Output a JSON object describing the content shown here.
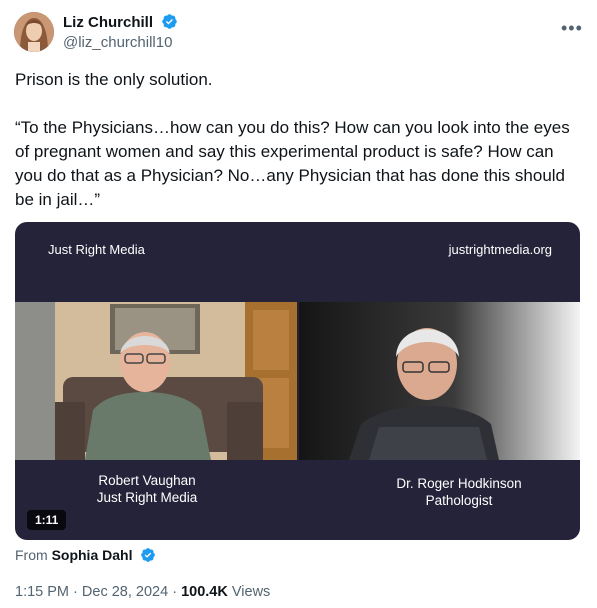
{
  "author": {
    "name": "Liz Churchill",
    "handle": "@liz_churchill10"
  },
  "tweet": {
    "text": "Prison is the only solution.\n\n“To the Physicians…how can you do this? How can you look into the eyes of pregnant women and say this experimental product is safe? How can you do that as a Physician? No…any Physician that has done this should be in jail…”"
  },
  "video": {
    "header_left": "Just Right Media",
    "header_right": "justrightmedia.org",
    "left_caption_name": "Robert Vaughan",
    "left_caption_org": "Just Right Media",
    "right_caption_name": "Dr. Roger Hodkinson",
    "right_caption_role": "Pathologist",
    "duration": "1:11"
  },
  "attribution": {
    "prefix": "From",
    "source": "Sophia Dahl"
  },
  "meta": {
    "time": "1:15 PM",
    "date": "Dec 28, 2024",
    "views_count": "100.4K",
    "views_label": "Views",
    "sep": "·"
  },
  "colors": {
    "verified": "#1d9bf0",
    "video_bg": "#252339",
    "secondary_text": "#536471"
  }
}
